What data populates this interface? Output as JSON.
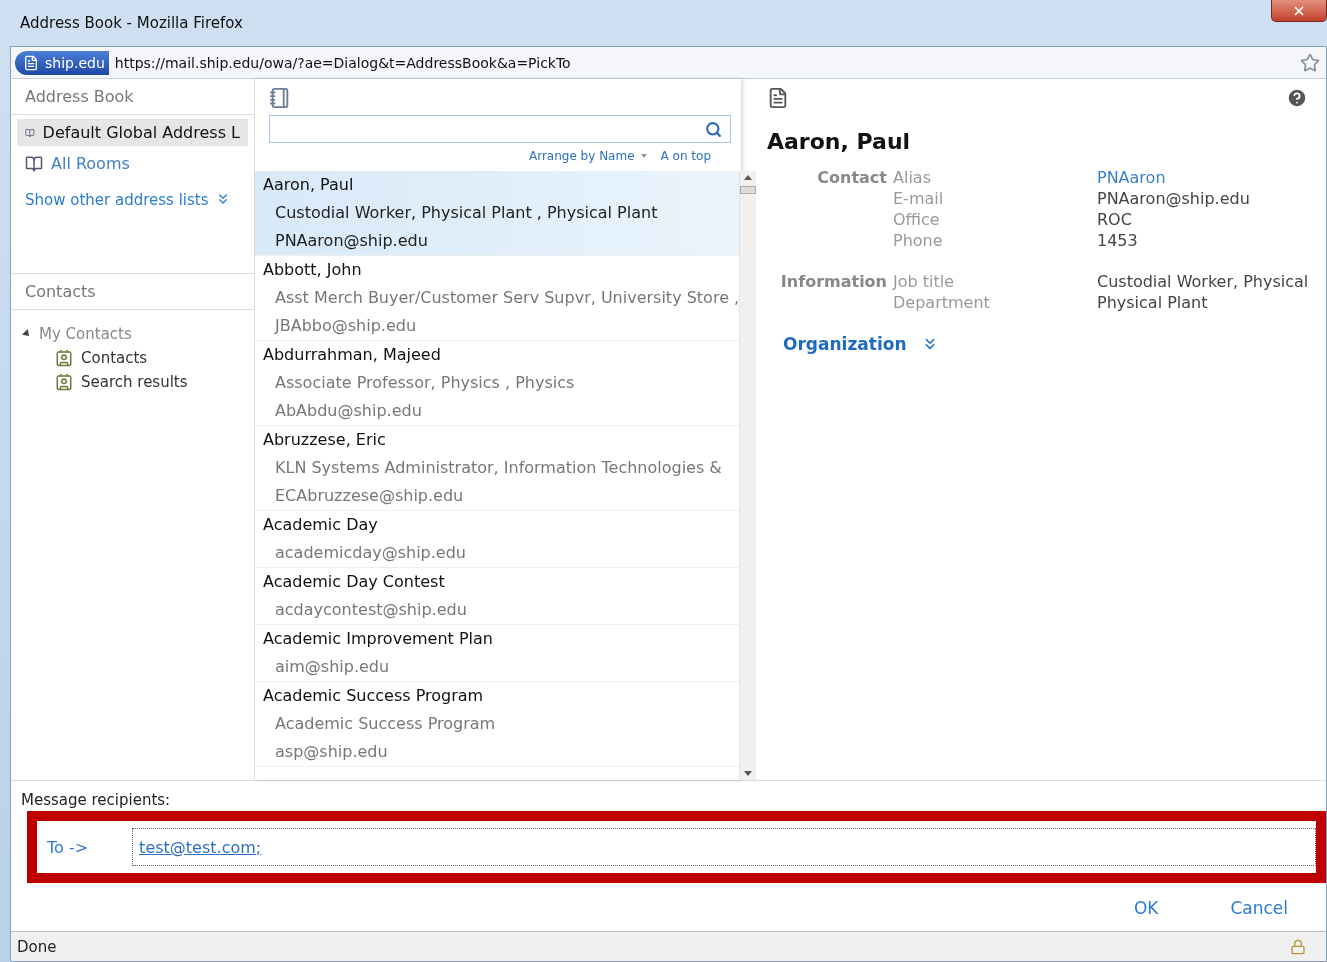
{
  "window": {
    "title": "Address Book - Mozilla Firefox"
  },
  "address_bar": {
    "site": "ship.edu",
    "url": "https://mail.ship.edu/owa/?ae=Dialog&t=AddressBook&a=PickTo"
  },
  "nav": {
    "heading": "Address Book",
    "lists": [
      {
        "label": "Default Global Address L",
        "selected": true
      },
      {
        "label": "All Rooms",
        "selected": false
      }
    ],
    "show_other": "Show other address lists",
    "contacts_heading": "Contacts",
    "tree": [
      {
        "label": "My Contacts",
        "expanded": true,
        "children": [
          {
            "label": "Contacts"
          },
          {
            "label": "Search results"
          }
        ]
      }
    ]
  },
  "list": {
    "arrange": "Arrange by Name",
    "order": "A on top",
    "entries": [
      {
        "name": "Aaron, Paul",
        "selected": true,
        "lines": [
          "Custodial Worker, Physical Plant , Physical Plant",
          "PNAaron@ship.edu"
        ]
      },
      {
        "name": "Abbott, John",
        "selected": false,
        "lines": [
          "Asst Merch Buyer/Customer Serv Supvr, University Store ,",
          "JBAbbo@ship.edu"
        ]
      },
      {
        "name": "Abdurrahman, Majeed",
        "selected": false,
        "lines": [
          "Associate Professor, Physics , Physics",
          "AbAbdu@ship.edu"
        ]
      },
      {
        "name": "Abruzzese, Eric",
        "selected": false,
        "lines": [
          "KLN Systems Administrator, Information Technologies &",
          "ECAbruzzese@ship.edu"
        ]
      },
      {
        "name": "Academic Day",
        "selected": false,
        "lines": [
          "academicday@ship.edu"
        ]
      },
      {
        "name": "Academic Day Contest",
        "selected": false,
        "lines": [
          "acdaycontest@ship.edu"
        ]
      },
      {
        "name": "Academic Improvement Plan",
        "selected": false,
        "lines": [
          "aim@ship.edu"
        ]
      },
      {
        "name": "Academic Success Program",
        "selected": false,
        "lines": [
          "Academic Success Program",
          "asp@ship.edu"
        ]
      }
    ]
  },
  "detail": {
    "name": "Aaron, Paul",
    "sections": [
      {
        "heading": "Contact",
        "fields": [
          {
            "label": "Alias",
            "value": "PNAaron",
            "kind": "link"
          },
          {
            "label": "E-mail",
            "value": "PNAaron@ship.edu",
            "kind": "text"
          },
          {
            "label": "Office",
            "value": "ROC",
            "kind": "text"
          },
          {
            "label": "Phone",
            "value": "1453",
            "kind": "text"
          }
        ]
      },
      {
        "heading": "Information",
        "fields": [
          {
            "label": "Job title",
            "value": "Custodial Worker, Physical",
            "kind": "text"
          },
          {
            "label": "Department",
            "value": "Physical Plant",
            "kind": "text"
          }
        ]
      }
    ],
    "organization": "Organization"
  },
  "recipients": {
    "label": "Message recipients:",
    "to_button": "To ->",
    "value": "test@test.com;"
  },
  "buttons": [
    "OK",
    "Cancel"
  ],
  "status_bar": "Done"
}
